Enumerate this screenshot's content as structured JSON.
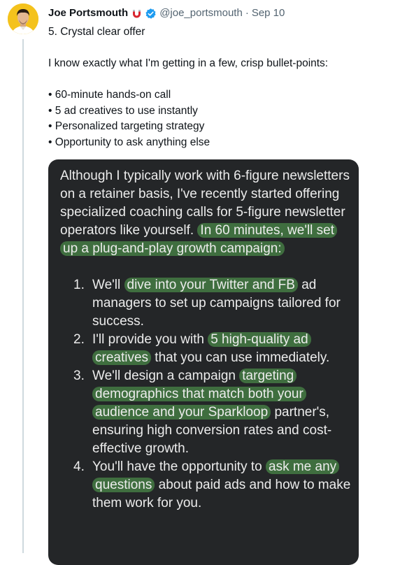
{
  "author": {
    "name": "Joe Portsmouth",
    "handle": "@joe_portsmouth",
    "separator": "·",
    "date": "Sep 10"
  },
  "tweet": {
    "heading": "5. Crystal clear offer",
    "intro": "I know exactly what I'm getting in a few, crisp bullet-points:",
    "bullets": [
      "• 60-minute hands-on call",
      "• 5 ad creatives to use instantly",
      "• Personalized targeting strategy",
      "• Opportunity to ask anything else"
    ]
  },
  "media": {
    "paragraph": {
      "before": "Although I typically work with 6-figure newsletters on a retainer basis, I've recently started offering specialized coaching calls for 5-figure newsletter operators like yourself. ",
      "highlight": "In 60 minutes, we'll set up a plug-and-play growth campaign:"
    },
    "items": [
      {
        "num": "1.",
        "before": "We'll ",
        "highlight": "dive into your Twitter and FB",
        "after": " ad managers to set up campaigns tailored for success."
      },
      {
        "num": "2.",
        "before": "I'll provide you with ",
        "highlight": "5 high-quality ad creatives",
        "after": " that you can use immediately."
      },
      {
        "num": "3.",
        "before": "We'll design a campaign ",
        "highlight": "targeting demographics that match both your audience and your Sparkloop",
        "after": " partner's, ensuring high conversion rates and cost-effective growth."
      },
      {
        "num": "4.",
        "before": "You'll have the opportunity to ",
        "highlight": "ask me any questions",
        "after": " about paid ads and how to make them work for you."
      }
    ]
  },
  "colors": {
    "verified": "#1d9bf0",
    "highlight": "#3f6e3f",
    "media_bg": "#242628",
    "magnet_red": "#d9262f"
  }
}
